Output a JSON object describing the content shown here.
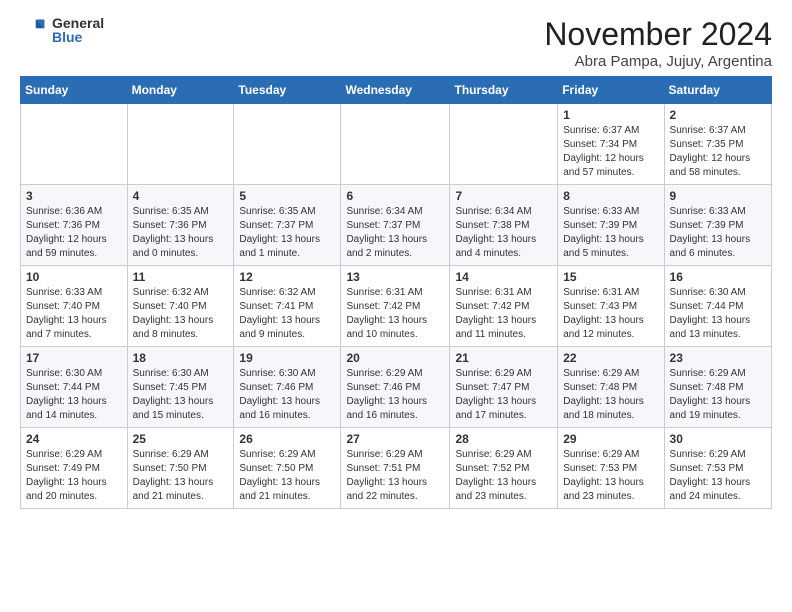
{
  "logo": {
    "general": "General",
    "blue": "Blue"
  },
  "header": {
    "month": "November 2024",
    "location": "Abra Pampa, Jujuy, Argentina"
  },
  "days_of_week": [
    "Sunday",
    "Monday",
    "Tuesday",
    "Wednesday",
    "Thursday",
    "Friday",
    "Saturday"
  ],
  "weeks": [
    [
      {
        "day": "",
        "content": ""
      },
      {
        "day": "",
        "content": ""
      },
      {
        "day": "",
        "content": ""
      },
      {
        "day": "",
        "content": ""
      },
      {
        "day": "",
        "content": ""
      },
      {
        "day": "1",
        "content": "Sunrise: 6:37 AM\nSunset: 7:34 PM\nDaylight: 12 hours\nand 57 minutes."
      },
      {
        "day": "2",
        "content": "Sunrise: 6:37 AM\nSunset: 7:35 PM\nDaylight: 12 hours\nand 58 minutes."
      }
    ],
    [
      {
        "day": "3",
        "content": "Sunrise: 6:36 AM\nSunset: 7:36 PM\nDaylight: 12 hours\nand 59 minutes."
      },
      {
        "day": "4",
        "content": "Sunrise: 6:35 AM\nSunset: 7:36 PM\nDaylight: 13 hours\nand 0 minutes."
      },
      {
        "day": "5",
        "content": "Sunrise: 6:35 AM\nSunset: 7:37 PM\nDaylight: 13 hours\nand 1 minute."
      },
      {
        "day": "6",
        "content": "Sunrise: 6:34 AM\nSunset: 7:37 PM\nDaylight: 13 hours\nand 2 minutes."
      },
      {
        "day": "7",
        "content": "Sunrise: 6:34 AM\nSunset: 7:38 PM\nDaylight: 13 hours\nand 4 minutes."
      },
      {
        "day": "8",
        "content": "Sunrise: 6:33 AM\nSunset: 7:39 PM\nDaylight: 13 hours\nand 5 minutes."
      },
      {
        "day": "9",
        "content": "Sunrise: 6:33 AM\nSunset: 7:39 PM\nDaylight: 13 hours\nand 6 minutes."
      }
    ],
    [
      {
        "day": "10",
        "content": "Sunrise: 6:33 AM\nSunset: 7:40 PM\nDaylight: 13 hours\nand 7 minutes."
      },
      {
        "day": "11",
        "content": "Sunrise: 6:32 AM\nSunset: 7:40 PM\nDaylight: 13 hours\nand 8 minutes."
      },
      {
        "day": "12",
        "content": "Sunrise: 6:32 AM\nSunset: 7:41 PM\nDaylight: 13 hours\nand 9 minutes."
      },
      {
        "day": "13",
        "content": "Sunrise: 6:31 AM\nSunset: 7:42 PM\nDaylight: 13 hours\nand 10 minutes."
      },
      {
        "day": "14",
        "content": "Sunrise: 6:31 AM\nSunset: 7:42 PM\nDaylight: 13 hours\nand 11 minutes."
      },
      {
        "day": "15",
        "content": "Sunrise: 6:31 AM\nSunset: 7:43 PM\nDaylight: 13 hours\nand 12 minutes."
      },
      {
        "day": "16",
        "content": "Sunrise: 6:30 AM\nSunset: 7:44 PM\nDaylight: 13 hours\nand 13 minutes."
      }
    ],
    [
      {
        "day": "17",
        "content": "Sunrise: 6:30 AM\nSunset: 7:44 PM\nDaylight: 13 hours\nand 14 minutes."
      },
      {
        "day": "18",
        "content": "Sunrise: 6:30 AM\nSunset: 7:45 PM\nDaylight: 13 hours\nand 15 minutes."
      },
      {
        "day": "19",
        "content": "Sunrise: 6:30 AM\nSunset: 7:46 PM\nDaylight: 13 hours\nand 16 minutes."
      },
      {
        "day": "20",
        "content": "Sunrise: 6:29 AM\nSunset: 7:46 PM\nDaylight: 13 hours\nand 16 minutes."
      },
      {
        "day": "21",
        "content": "Sunrise: 6:29 AM\nSunset: 7:47 PM\nDaylight: 13 hours\nand 17 minutes."
      },
      {
        "day": "22",
        "content": "Sunrise: 6:29 AM\nSunset: 7:48 PM\nDaylight: 13 hours\nand 18 minutes."
      },
      {
        "day": "23",
        "content": "Sunrise: 6:29 AM\nSunset: 7:48 PM\nDaylight: 13 hours\nand 19 minutes."
      }
    ],
    [
      {
        "day": "24",
        "content": "Sunrise: 6:29 AM\nSunset: 7:49 PM\nDaylight: 13 hours\nand 20 minutes."
      },
      {
        "day": "25",
        "content": "Sunrise: 6:29 AM\nSunset: 7:50 PM\nDaylight: 13 hours\nand 21 minutes."
      },
      {
        "day": "26",
        "content": "Sunrise: 6:29 AM\nSunset: 7:50 PM\nDaylight: 13 hours\nand 21 minutes."
      },
      {
        "day": "27",
        "content": "Sunrise: 6:29 AM\nSunset: 7:51 PM\nDaylight: 13 hours\nand 22 minutes."
      },
      {
        "day": "28",
        "content": "Sunrise: 6:29 AM\nSunset: 7:52 PM\nDaylight: 13 hours\nand 23 minutes."
      },
      {
        "day": "29",
        "content": "Sunrise: 6:29 AM\nSunset: 7:53 PM\nDaylight: 13 hours\nand 23 minutes."
      },
      {
        "day": "30",
        "content": "Sunrise: 6:29 AM\nSunset: 7:53 PM\nDaylight: 13 hours\nand 24 minutes."
      }
    ]
  ]
}
